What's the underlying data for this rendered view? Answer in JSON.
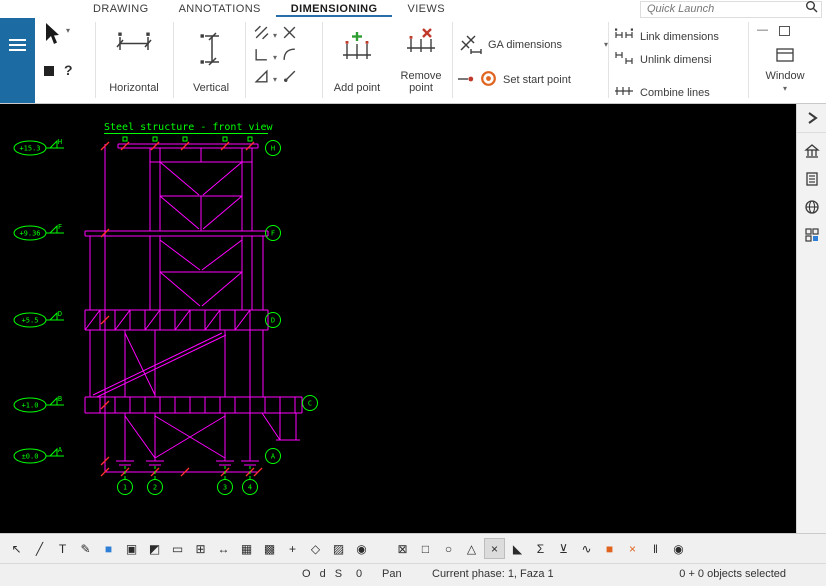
{
  "tabbar": {
    "tabs": [
      {
        "label": "DRAWING"
      },
      {
        "label": "ANNOTATIONS"
      },
      {
        "label": "DIMENSIONING"
      },
      {
        "label": "VIEWS"
      }
    ],
    "active_tab": "DIMENSIONING",
    "quick_launch_placeholder": "Quick Launch"
  },
  "ribbon": {
    "horizontal": "Horizontal",
    "vertical": "Vertical",
    "add_point": "Add point",
    "remove_point_line1": "Remove",
    "remove_point_line2": "point",
    "ga_dimensions": "GA dimensions",
    "set_start_point": "Set start point",
    "link_dimensions": "Link dimensions",
    "unlink_dimensions": "Unlink dimensi",
    "combine_lines": "Combine lines",
    "window_label": "Window",
    "tool_icons": [
      "free-dimension",
      "crossing-dimension",
      "perpendicular-dimension",
      "curved-dimension",
      "angle-dimension",
      "radial-dimension"
    ]
  },
  "canvas": {
    "title": "Steel structure - front view",
    "levels": [
      "+15.3",
      "+9.36",
      "+5.5",
      "+1.0",
      "±0.0"
    ],
    "left_letters": [
      "H",
      "F",
      "D",
      "B",
      "A"
    ],
    "right_letters": [
      "H",
      "F",
      "D",
      "A"
    ],
    "cantilever_letter": "C",
    "grid_numbers": [
      "1",
      "2",
      "3",
      "4"
    ],
    "colors": {
      "background": "#000000",
      "structure": "#ff00ff",
      "annotations": "#00ff00",
      "ticks": "#ff3030"
    }
  },
  "sidebar": {
    "icons": [
      "collapse-panel",
      "reference-models",
      "document-manager",
      "web-browser",
      "components"
    ]
  },
  "bottom_toolbar": {
    "left_icons": [
      {
        "name": "select-cursor",
        "glyph": "↖"
      },
      {
        "name": "line-tool",
        "glyph": "╱"
      },
      {
        "name": "text-tool",
        "glyph": "T"
      },
      {
        "name": "freehand-tool",
        "glyph": "✎"
      },
      {
        "name": "area-select",
        "glyph": "■"
      },
      {
        "name": "smart-select",
        "glyph": "▣"
      },
      {
        "name": "hatch-tool",
        "glyph": "◩"
      },
      {
        "name": "window-select",
        "glyph": "▭"
      },
      {
        "name": "viewport-tool",
        "glyph": "⊞"
      },
      {
        "name": "stretch-tool",
        "glyph": "↔"
      },
      {
        "name": "grid-toggle",
        "glyph": "▦"
      },
      {
        "name": "snap-grid",
        "glyph": "▩"
      },
      {
        "name": "snap-point",
        "glyph": "+"
      },
      {
        "name": "pan-tool",
        "glyph": "◇"
      },
      {
        "name": "halftone-toggle",
        "glyph": "▨"
      },
      {
        "name": "visibility-toggle",
        "glyph": "◉"
      }
    ],
    "right_icons": [
      {
        "name": "filter-frame",
        "glyph": "⊠"
      },
      {
        "name": "filter-rectangle",
        "glyph": "□"
      },
      {
        "name": "filter-circle",
        "glyph": "○"
      },
      {
        "name": "filter-triangle",
        "glyph": "△"
      },
      {
        "name": "filter-cross",
        "glyph": "×"
      },
      {
        "name": "filter-angle",
        "glyph": "◣"
      },
      {
        "name": "filter-section",
        "glyph": "Σ"
      },
      {
        "name": "filter-logic",
        "glyph": "⊻"
      },
      {
        "name": "filter-curve",
        "glyph": "∿"
      },
      {
        "name": "weld-toggle",
        "glyph": "■"
      },
      {
        "name": "bolt-toggle",
        "glyph": "×"
      },
      {
        "name": "dim-pair",
        "glyph": "‖"
      },
      {
        "name": "visibility-toggle-2",
        "glyph": "◉"
      }
    ]
  },
  "statusbar": {
    "snap_indicators": "O d S",
    "count": "0",
    "mode": "Pan",
    "phase": "Current phase: 1, Faza 1",
    "selection": "0 + 0 objects selected"
  }
}
